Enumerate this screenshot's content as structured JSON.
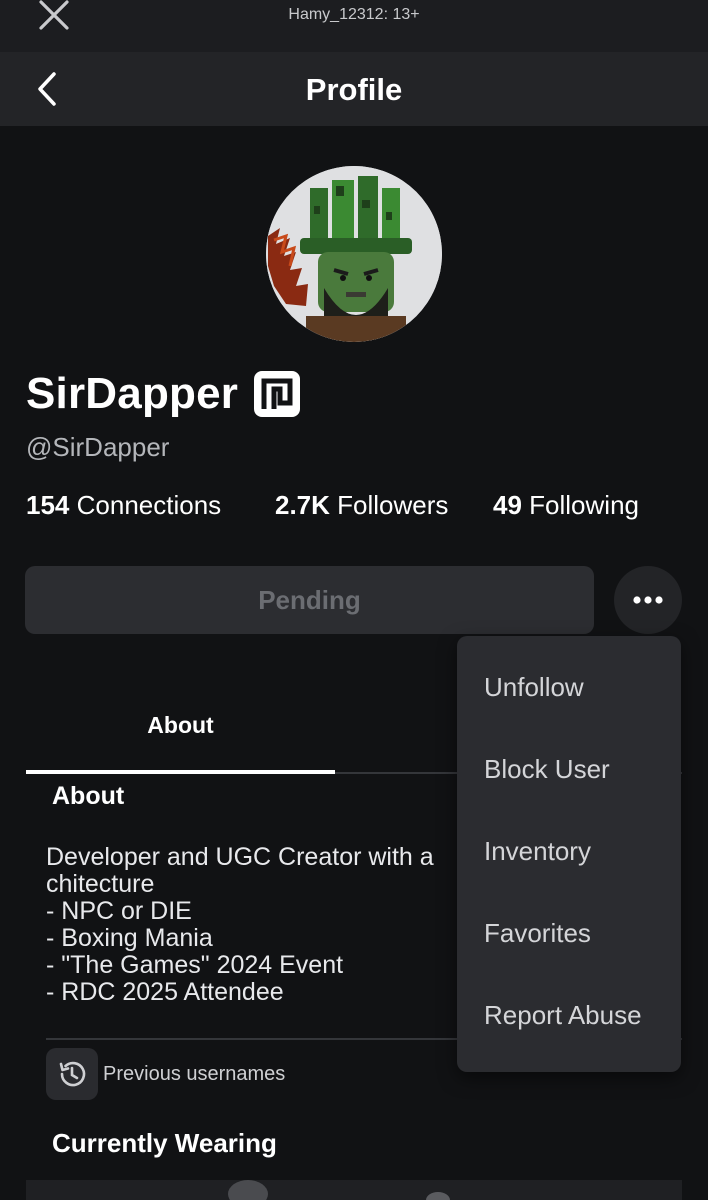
{
  "status_bar": {
    "title": "Hamy_12312: 13+"
  },
  "header": {
    "title": "Profile"
  },
  "profile": {
    "display_name": "SirDapper",
    "handle": "@SirDapper",
    "stats": {
      "connections_count": "154",
      "connections_label": "Connections",
      "followers_count": "2.7K",
      "followers_label": "Followers",
      "following_count": "49",
      "following_label": "Following"
    }
  },
  "actions": {
    "pending_label": "Pending"
  },
  "tabs": [
    {
      "label": "About"
    }
  ],
  "about": {
    "heading": "About",
    "body": "Developer and UGC Creator with a\nchitecture\n- NPC or DIE\n- Boxing Mania\n- \"The Games\" 2024 Event\n- RDC 2025 Attendee"
  },
  "previous_usernames": {
    "label": "Previous usernames"
  },
  "currently_wearing": {
    "heading": "Currently Wearing"
  },
  "menu": {
    "items": [
      {
        "label": "Unfollow"
      },
      {
        "label": "Block User"
      },
      {
        "label": "Inventory"
      },
      {
        "label": "Favorites"
      },
      {
        "label": "Report Abuse"
      }
    ]
  },
  "colors": {
    "background": "#111214",
    "header": "#232427",
    "button": "#2c2d31",
    "menu": "#2b2c30"
  }
}
